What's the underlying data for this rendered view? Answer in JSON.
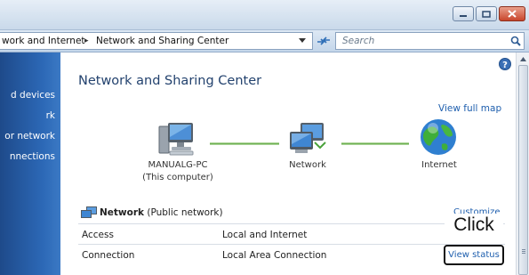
{
  "window": {
    "controls": [
      "minimize-icon",
      "maximize-icon",
      "close-icon"
    ],
    "colors": {
      "titlebar": "#c9d9ea",
      "close": "#c9462c"
    }
  },
  "address": {
    "crumb1": "work and Internet",
    "crumb2": "Network and Sharing Center",
    "separator": "▸"
  },
  "search": {
    "placeholder": "Search"
  },
  "sidebar": {
    "items": [
      {
        "label": "d devices"
      },
      {
        "label": "rk"
      },
      {
        "label": "or network"
      },
      {
        "label": "nnections"
      }
    ],
    "color": "#2c68b6"
  },
  "main": {
    "title": "Network and Sharing Center",
    "view_full_map": "View full map",
    "map": {
      "computer_name": "MANUALG-PC",
      "computer_sub": "(This computer)",
      "network": "Network",
      "internet": "Internet"
    },
    "network_section": {
      "name": "Network",
      "type": "(Public network)",
      "customize": "Customize",
      "rows": [
        {
          "label": "Access",
          "value": "Local and Internet"
        },
        {
          "label": "Connection",
          "value": "Local Area Connection"
        }
      ],
      "view_status": "View status"
    }
  },
  "callout": {
    "text": "Click"
  }
}
